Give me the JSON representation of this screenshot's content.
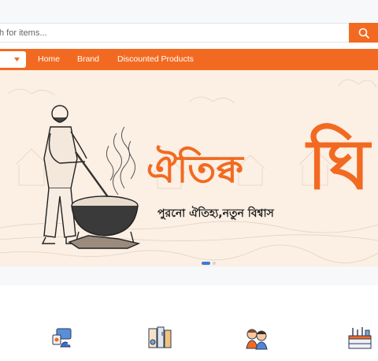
{
  "search": {
    "placeholder": "h for items..."
  },
  "icons": {
    "search_button": "search-icon",
    "category_dropdown": "chevron-down-icon"
  },
  "nav": {
    "items": [
      "Home",
      "Brand",
      "Discounted Products"
    ]
  },
  "banner": {
    "headline": "ঐতিহ্য",
    "headline_partial": "ঐতিক্ব",
    "headline_cut": "ঘি",
    "tagline": "পুরনো ঐতিহ্য,নতুন বিশ্বাস"
  },
  "carousel": {
    "slides": 2,
    "active": 1
  },
  "categories": [
    {
      "icon": "electronics-icon"
    },
    {
      "icon": "home-appliance-icon"
    },
    {
      "icon": "kids-icon"
    },
    {
      "icon": "kitchen-icon"
    }
  ],
  "colors": {
    "brand": "#f26a21",
    "banner_bg": "#fcefe4",
    "dot_active": "#3b7bd6"
  }
}
